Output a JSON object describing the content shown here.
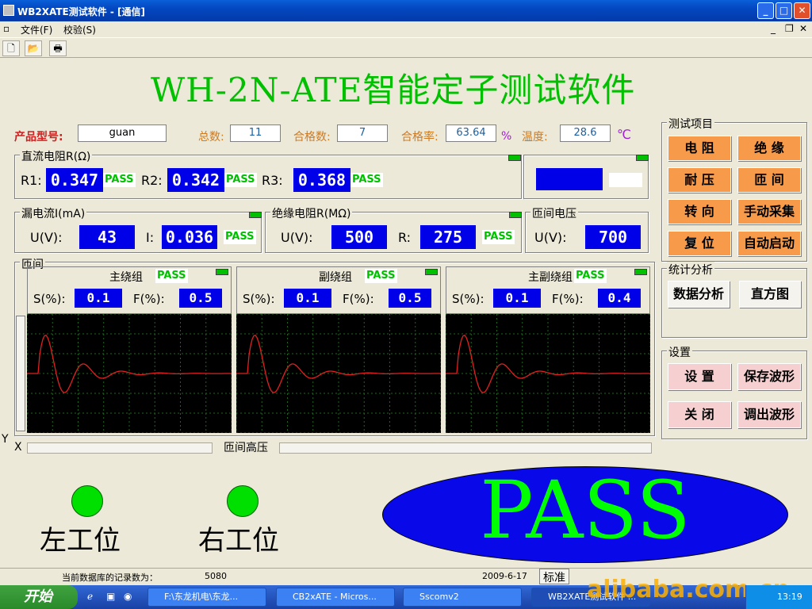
{
  "window": {
    "title": "WB2XATE测试软件 - [通信]",
    "min": "_",
    "max": "□",
    "close": "✕"
  },
  "menu": {
    "file": "文件(F)",
    "verify": "校验(S)",
    "mdi_min": "_",
    "mdi_restore": "❐",
    "mdi_close": "✕"
  },
  "app": {
    "title": "WH-2N-ATE智能定子测试软件"
  },
  "info": {
    "model_label": "产品型号:",
    "model": "guan",
    "total_label": "总数:",
    "total": "11",
    "ok_label": "合格数:",
    "ok": "7",
    "rate_label": "合格率:",
    "rate": "63.64",
    "rate_unit": "%",
    "temp_label": "温度:",
    "temp": "28.6",
    "temp_unit": "℃"
  },
  "dcr": {
    "title": "直流电阻R(Ω)",
    "r1_label": "R1:",
    "r1": "0.347",
    "r2_label": "R2:",
    "r2": "0.342",
    "r3_label": "R3:",
    "r3": "0.368",
    "pass": "PASS"
  },
  "leak": {
    "title": "漏电流I(mA)",
    "u_label": "U(V):",
    "u": "43",
    "i_label": "I:",
    "i": "0.036",
    "pass": "PASS"
  },
  "ins": {
    "title": "绝缘电阻R(MΩ)",
    "u_label": "U(V):",
    "u": "500",
    "r_label": "R:",
    "r": "275",
    "pass": "PASS"
  },
  "turn": {
    "title": "匝间电压",
    "u_label": "U(V):",
    "u": "700"
  },
  "turngroup": {
    "title": "匝间",
    "pass": "PASS",
    "s_label": "S(%):",
    "f_label": "F(%):",
    "panels": [
      {
        "name": "主绕组",
        "s": "0.1",
        "f": "0.5"
      },
      {
        "name": "副绕组",
        "s": "0.1",
        "f": "0.5"
      },
      {
        "name": "主副绕组",
        "s": "0.1",
        "f": "0.4"
      }
    ]
  },
  "axes": {
    "y": "Y",
    "x": "X",
    "hv": "匝间高压"
  },
  "test_items": {
    "title": "测试项目",
    "buttons": [
      "电 阻",
      "绝 缘",
      "耐 压",
      "匝 间",
      "转 向",
      "手动采集",
      "复 位",
      "自动启动"
    ]
  },
  "stats": {
    "title": "统计分析",
    "data": "数据分析",
    "hist": "直方图"
  },
  "settings": {
    "title": "设置",
    "set": "设 置",
    "save": "保存波形",
    "close": "关 闭",
    "load": "调出波形"
  },
  "stations": {
    "left": "左工位",
    "right": "右工位"
  },
  "result": {
    "text": "PASS"
  },
  "status": {
    "records_label": "当前数据库的记录数为：",
    "records": "5080",
    "date": "2009-6-17",
    "ime": "标准"
  },
  "taskbar": {
    "start": "开始",
    "tasks": [
      "F:\\东龙机电\\东龙...",
      "CB2xATE - Micros...",
      "Sscomv2",
      "WB2XATE测试软件 ..."
    ],
    "watermark": "alibaba.com.cn",
    "clock": "13:19"
  },
  "colors": {
    "accent": "#0000e8",
    "pass": "#00c000",
    "button": "#f79a4a"
  }
}
